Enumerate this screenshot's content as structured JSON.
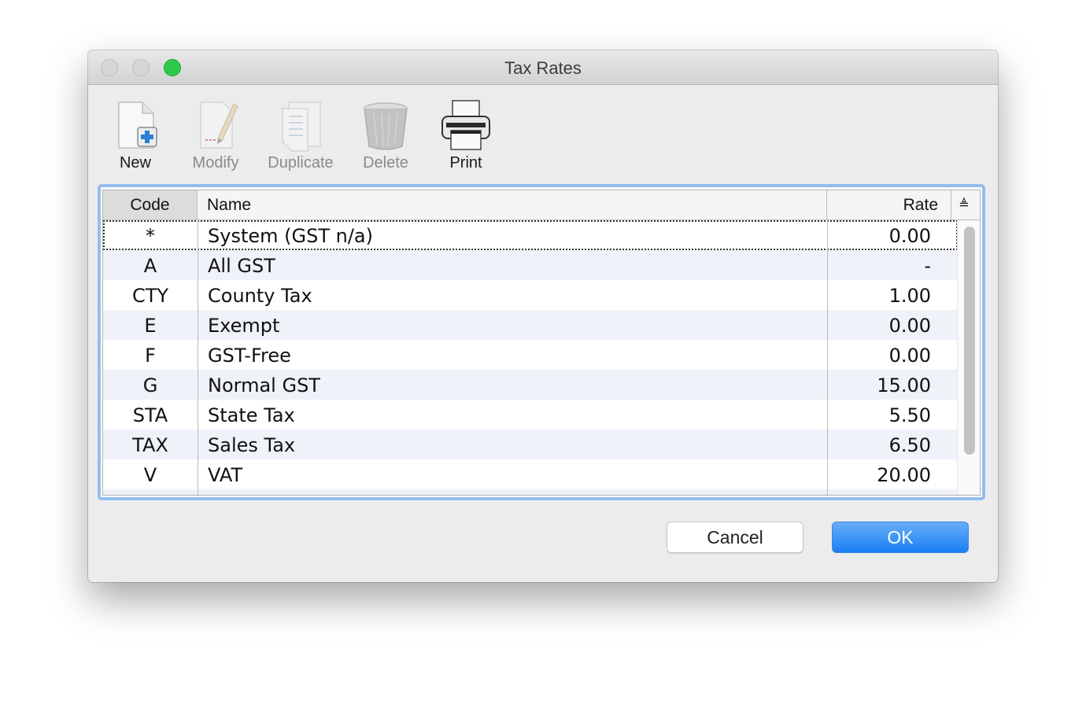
{
  "window": {
    "title": "Tax Rates"
  },
  "toolbar": {
    "items": [
      {
        "label": "New",
        "icon": "new-document-icon",
        "enabled": true
      },
      {
        "label": "Modify",
        "icon": "edit-document-icon",
        "enabled": false
      },
      {
        "label": "Duplicate",
        "icon": "duplicate-document-icon",
        "enabled": false
      },
      {
        "label": "Delete",
        "icon": "trash-icon",
        "enabled": false
      },
      {
        "label": "Print",
        "icon": "printer-icon",
        "enabled": true
      }
    ]
  },
  "table": {
    "columns": {
      "code": "Code",
      "name": "Name",
      "rate": "Rate",
      "sorter": "≜"
    },
    "rows": [
      {
        "code": "*",
        "name": "System (GST n/a)",
        "rate": "0.00",
        "selected": true
      },
      {
        "code": "A",
        "name": "All GST",
        "rate": "-"
      },
      {
        "code": "CTY",
        "name": "County Tax",
        "rate": "1.00"
      },
      {
        "code": "E",
        "name": "Exempt",
        "rate": "0.00"
      },
      {
        "code": "F",
        "name": "GST-Free",
        "rate": "0.00"
      },
      {
        "code": "G",
        "name": "Normal GST",
        "rate": "15.00"
      },
      {
        "code": "STA",
        "name": "State Tax",
        "rate": "5.50"
      },
      {
        "code": "TAX",
        "name": "Sales Tax",
        "rate": "6.50"
      },
      {
        "code": "V",
        "name": "VAT",
        "rate": "20.00"
      }
    ]
  },
  "buttons": {
    "cancel": "Cancel",
    "ok": "OK"
  },
  "colors": {
    "accent": "#1a7ef5",
    "focus_ring": "#93bdee",
    "alt_row": "#eff2f8"
  }
}
